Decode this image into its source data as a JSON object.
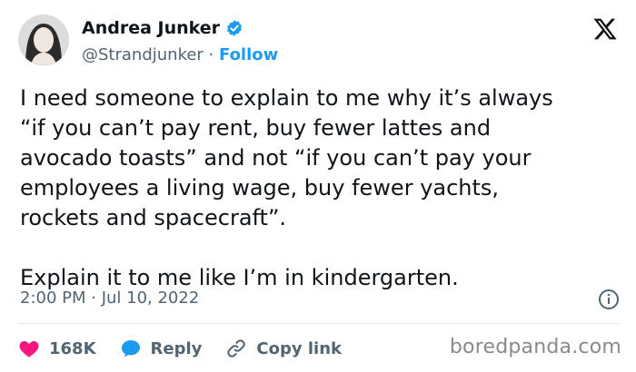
{
  "author": {
    "name": "Andrea Junker",
    "handle": "@Strandjunker",
    "separator": " · ",
    "follow_label": "Follow"
  },
  "tweet": {
    "text": "I need someone to explain to me why it’s always\n“if you can’t pay rent, buy fewer lattes and\navocado toasts” and not “if you can’t pay your\nemployees a living wage, buy fewer yachts,\nrockets and spacecraft”.\n\nExplain it to me like I’m in kindergarten.",
    "timestamp": "2:00 PM · Jul 10, 2022"
  },
  "actions": {
    "likes": "168K",
    "reply_label": "Reply",
    "copy_link_label": "Copy link"
  },
  "watermark": "boredpanda.com",
  "colors": {
    "accent": "#1d9bf0",
    "like": "#f91880",
    "text": "#0f1419",
    "secondary": "#536471"
  },
  "icons": [
    "verified-badge-icon",
    "x-logo-icon",
    "info-icon",
    "heart-icon",
    "reply-bubble-icon",
    "link-icon"
  ]
}
